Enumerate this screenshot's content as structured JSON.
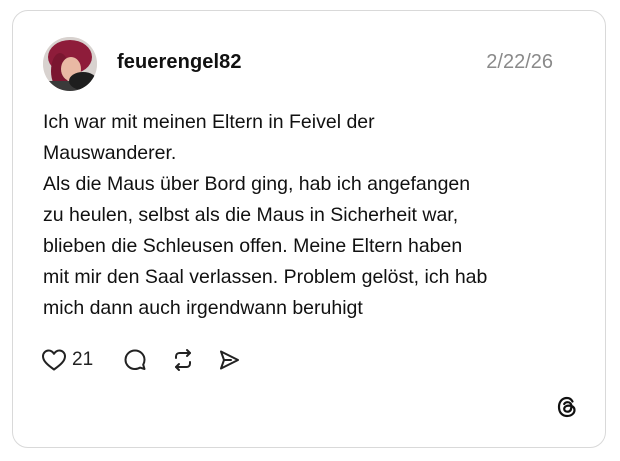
{
  "post": {
    "username": "feuerengel82",
    "date": "2/22/26",
    "text": "Ich war mit meinen Eltern in Feivel der\nMauswanderer.\nAls die Maus über Bord ging, hab ich angefangen\nzu heulen, selbst als die Maus in Sicherheit war,\nblieben die Schleusen offen. Meine Eltern haben\nmit mir den Saal verlassen. Problem gelöst, ich hab\nmich dann auch irgendwann beruhigt",
    "likes": "21"
  },
  "icons": {
    "like": "heart-icon",
    "reply": "comment-bubble-icon",
    "repost": "repost-icon",
    "share": "send-icon",
    "brand": "threads-logo-icon"
  },
  "colors": {
    "text": "#111111",
    "muted": "#8a8a8a",
    "border": "#d9d9d9",
    "background": "#ffffff"
  }
}
